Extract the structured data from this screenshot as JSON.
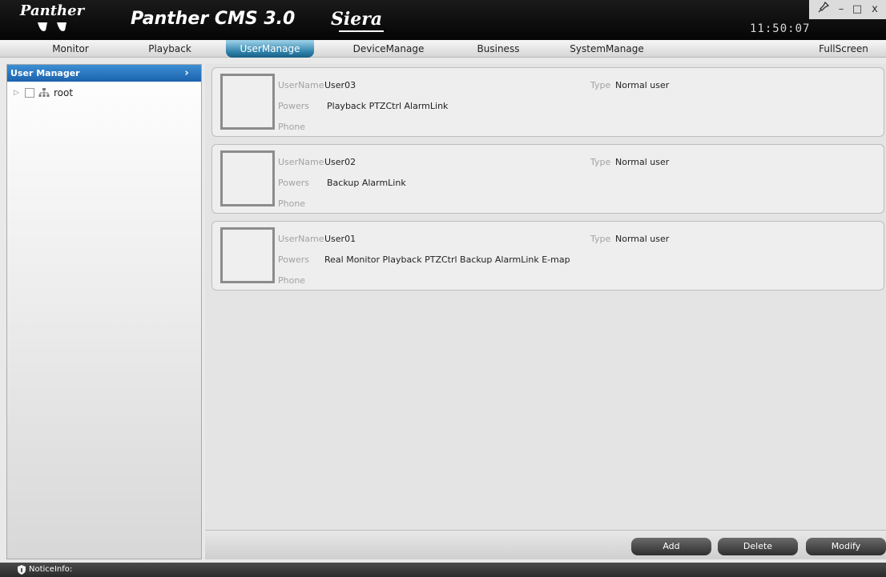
{
  "titlebar": {
    "logo_text": "Panther",
    "app_title": "Panther CMS 3.0",
    "brand": "Siera",
    "clock": "11:50:07",
    "window_buttons": {
      "pin": "pin-icon",
      "minimize": "–",
      "maximize": "□",
      "close": "x"
    }
  },
  "nav": {
    "items": [
      {
        "label": "Monitor"
      },
      {
        "label": "Playback"
      },
      {
        "label": "UserManage"
      },
      {
        "label": "DeviceManage"
      },
      {
        "label": "Business"
      },
      {
        "label": "SystemManage"
      },
      {
        "label": "FullScreen"
      }
    ],
    "active": "UserManage"
  },
  "sidebar": {
    "header": "User Manager",
    "arrow": "›",
    "tree": [
      {
        "label": "root",
        "expander": "▷",
        "icon": "network-group-icon"
      }
    ]
  },
  "users": [
    {
      "username_label": "UserName",
      "username": "User03",
      "powers_label": "Powers",
      "powers": "Playback PTZCtrl AlarmLink",
      "phone_label": "Phone",
      "phone": "",
      "type_label": "Type",
      "type": "Normal user"
    },
    {
      "username_label": "UserName",
      "username": "User02",
      "powers_label": "Powers",
      "powers": "Backup AlarmLink",
      "phone_label": "Phone",
      "phone": "",
      "type_label": "Type",
      "type": "Normal user"
    },
    {
      "username_label": "UserName",
      "username": "User01",
      "powers_label": "Powers",
      "powers": "Real Monitor Playback PTZCtrl Backup AlarmLink E-map",
      "phone_label": "Phone",
      "phone": "",
      "type_label": "Type",
      "type": "Normal user"
    }
  ],
  "actions": {
    "add": "Add",
    "delete": "Delete",
    "modify": "Modify"
  },
  "status": {
    "notice_label": "NoticeInfo:"
  },
  "colors": {
    "titlebar": "#0d0d0d",
    "nav_active": "#2c7fa8",
    "sidebar_header": "#1b62ad",
    "button": "#3a3a3a",
    "statusbar": "#333333"
  }
}
